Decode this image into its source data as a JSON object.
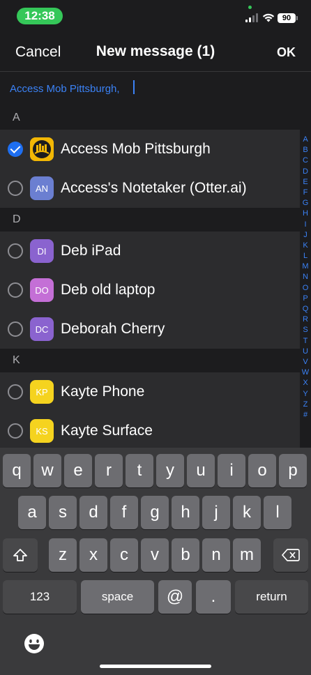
{
  "status": {
    "time": "12:38",
    "battery": "90"
  },
  "nav": {
    "cancel": "Cancel",
    "title": "New message (1)",
    "ok": "OK"
  },
  "recipients": {
    "text": "Access Mob Pittsburgh,"
  },
  "sections": [
    {
      "letter": "A",
      "rows": [
        {
          "name": "Access Mob Pittsburgh",
          "initials": "",
          "checked": true,
          "color": "#f2b705"
        },
        {
          "name": "Access's Notetaker (Otter.ai)",
          "initials": "AN",
          "checked": false,
          "color": "#6b7fd1"
        }
      ]
    },
    {
      "letter": "D",
      "rows": [
        {
          "name": "Deb iPad",
          "initials": "DI",
          "checked": false,
          "color": "#8a63cf"
        },
        {
          "name": "Deb old laptop",
          "initials": "DO",
          "checked": false,
          "color": "#c46fd6"
        },
        {
          "name": "Deborah Cherry",
          "initials": "DC",
          "checked": false,
          "color": "#8a63cf"
        }
      ]
    },
    {
      "letter": "K",
      "rows": [
        {
          "name": "Kayte Phone",
          "initials": "KP",
          "checked": false,
          "color": "#f5d31f"
        },
        {
          "name": "Kayte Surface",
          "initials": "KS",
          "checked": false,
          "color": "#f5d31f"
        }
      ]
    }
  ],
  "index": [
    "A",
    "B",
    "C",
    "D",
    "E",
    "F",
    "G",
    "H",
    "I",
    "J",
    "K",
    "L",
    "M",
    "N",
    "O",
    "P",
    "Q",
    "R",
    "S",
    "T",
    "U",
    "V",
    "W",
    "X",
    "Y",
    "Z",
    "#"
  ],
  "keyboard": {
    "row1": [
      "q",
      "w",
      "e",
      "r",
      "t",
      "y",
      "u",
      "i",
      "o",
      "p"
    ],
    "row2": [
      "a",
      "s",
      "d",
      "f",
      "g",
      "h",
      "j",
      "k",
      "l"
    ],
    "row3": [
      "z",
      "x",
      "c",
      "v",
      "b",
      "n",
      "m"
    ],
    "numbers": "123",
    "space": "space",
    "at": "@",
    "period": ".",
    "return": "return"
  },
  "colors": {
    "accent": "#3b82f6",
    "check": "#1e6ff1",
    "status_green": "#35c759"
  }
}
